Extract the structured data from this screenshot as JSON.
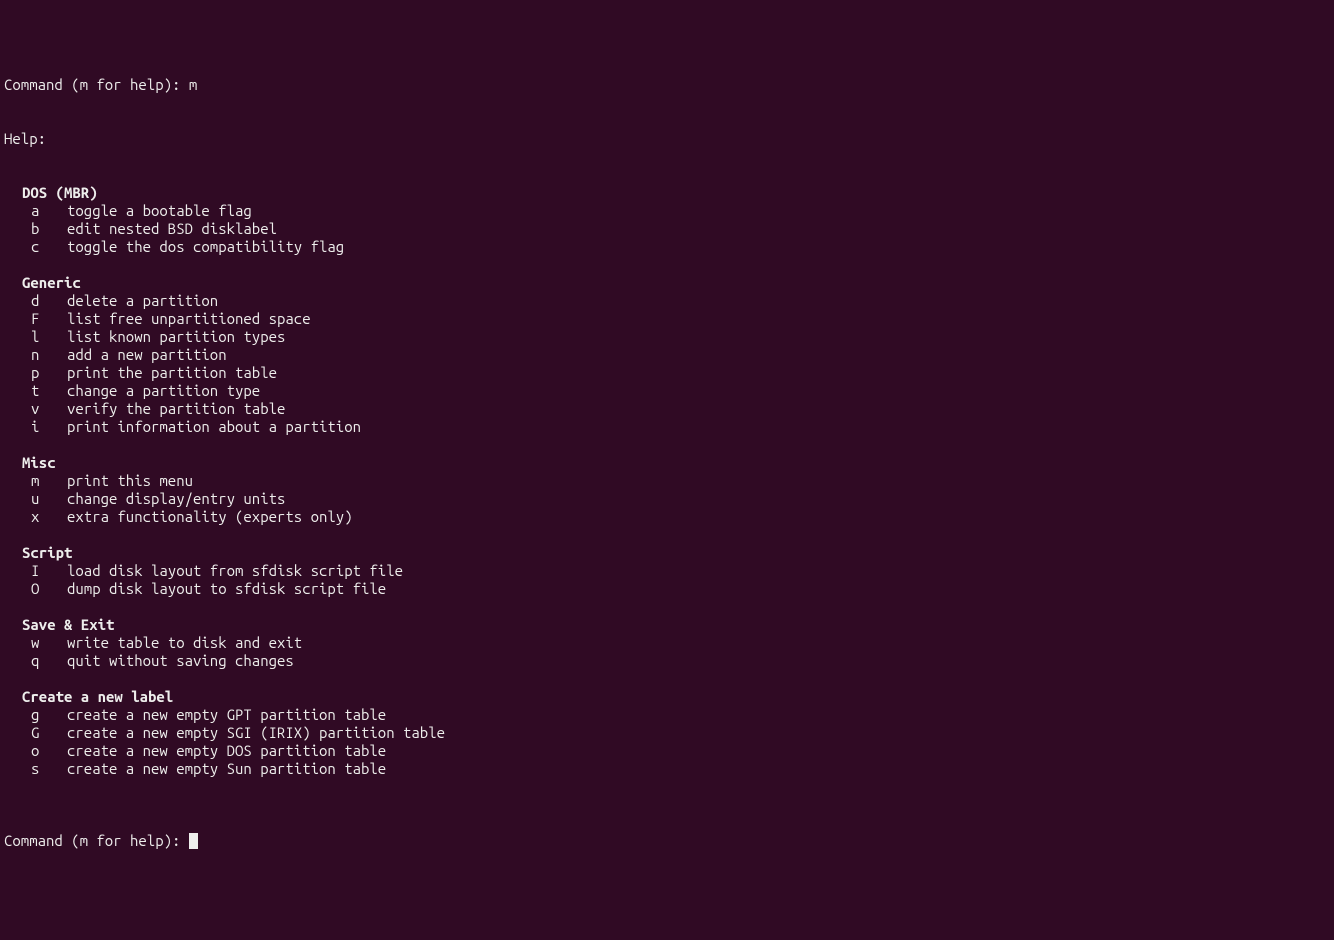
{
  "promptTop": {
    "label": "Command (m for help): ",
    "input": "m"
  },
  "helpHeader": "Help:",
  "sections": [
    {
      "heading": "DOS (MBR)",
      "commands": [
        {
          "key": "a",
          "desc": "toggle a bootable flag"
        },
        {
          "key": "b",
          "desc": "edit nested BSD disklabel"
        },
        {
          "key": "c",
          "desc": "toggle the dos compatibility flag"
        }
      ]
    },
    {
      "heading": "Generic",
      "commands": [
        {
          "key": "d",
          "desc": "delete a partition"
        },
        {
          "key": "F",
          "desc": "list free unpartitioned space"
        },
        {
          "key": "l",
          "desc": "list known partition types"
        },
        {
          "key": "n",
          "desc": "add a new partition"
        },
        {
          "key": "p",
          "desc": "print the partition table"
        },
        {
          "key": "t",
          "desc": "change a partition type"
        },
        {
          "key": "v",
          "desc": "verify the partition table"
        },
        {
          "key": "i",
          "desc": "print information about a partition"
        }
      ]
    },
    {
      "heading": "Misc",
      "commands": [
        {
          "key": "m",
          "desc": "print this menu"
        },
        {
          "key": "u",
          "desc": "change display/entry units"
        },
        {
          "key": "x",
          "desc": "extra functionality (experts only)"
        }
      ]
    },
    {
      "heading": "Script",
      "commands": [
        {
          "key": "I",
          "desc": "load disk layout from sfdisk script file"
        },
        {
          "key": "O",
          "desc": "dump disk layout to sfdisk script file"
        }
      ]
    },
    {
      "heading": "Save & Exit",
      "commands": [
        {
          "key": "w",
          "desc": "write table to disk and exit"
        },
        {
          "key": "q",
          "desc": "quit without saving changes"
        }
      ]
    },
    {
      "heading": "Create a new label",
      "commands": [
        {
          "key": "g",
          "desc": "create a new empty GPT partition table"
        },
        {
          "key": "G",
          "desc": "create a new empty SGI (IRIX) partition table"
        },
        {
          "key": "o",
          "desc": "create a new empty DOS partition table"
        },
        {
          "key": "s",
          "desc": "create a new empty Sun partition table"
        }
      ]
    }
  ],
  "promptBottom": {
    "label": "Command (m for help): "
  }
}
